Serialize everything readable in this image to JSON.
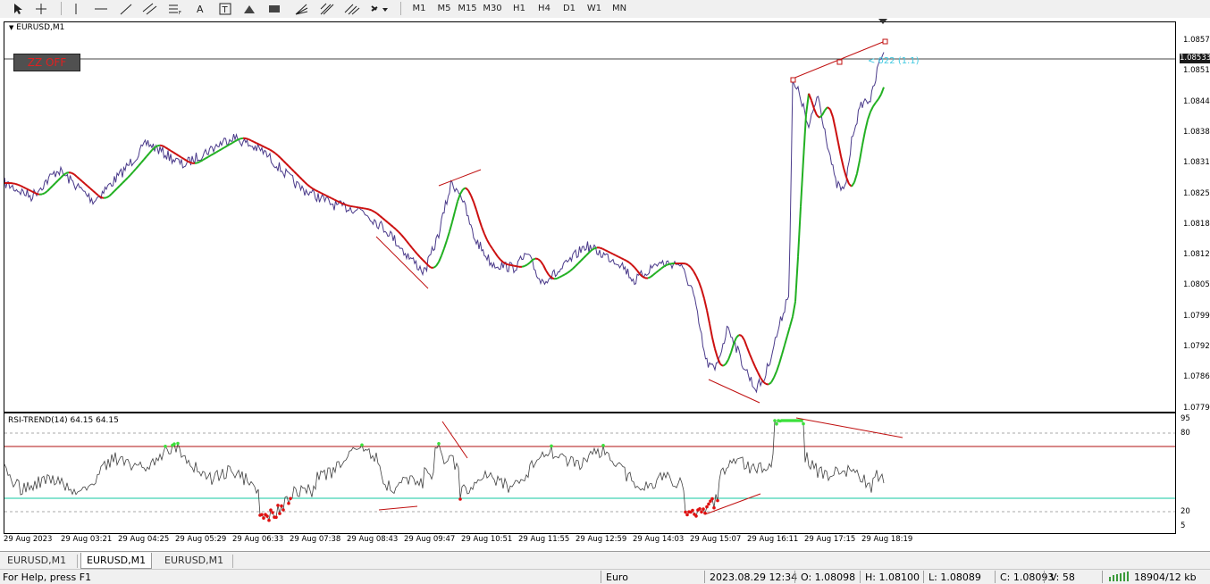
{
  "toolbar": {
    "timeframes": [
      "M1",
      "M5",
      "M15",
      "M30",
      "H1",
      "H4",
      "D1",
      "W1",
      "MN"
    ]
  },
  "main_chart": {
    "symbol_label": "EURUSD,M1",
    "zz_button": "ZZ OFF",
    "annotation": "< 022 (1.1)",
    "current_price": "1.08533",
    "price_ticks": [
      "1.08575",
      "1.08510",
      "1.08445",
      "1.08380",
      "1.08315",
      "1.08250",
      "1.08185",
      "1.08120",
      "1.08055",
      "1.07990",
      "1.07925",
      "1.07860",
      "1.07795"
    ]
  },
  "indicator": {
    "title": "RSI-TREND(14) 64.15 64.15",
    "levels": [
      "95",
      "80",
      "20",
      "5"
    ]
  },
  "time_axis": [
    "29 Aug 2023",
    "29 Aug 03:21",
    "29 Aug 04:25",
    "29 Aug 05:29",
    "29 Aug 06:33",
    "29 Aug 07:38",
    "29 Aug 08:43",
    "29 Aug 09:47",
    "29 Aug 10:51",
    "29 Aug 11:55",
    "29 Aug 12:59",
    "29 Aug 14:03",
    "29 Aug 15:07",
    "29 Aug 16:11",
    "29 Aug 17:15",
    "29 Aug 18:19"
  ],
  "tabs": [
    {
      "label": "EURUSD,M1",
      "active": false
    },
    {
      "label": "EURUSD,M1",
      "active": true
    },
    {
      "label": "EURUSD,M1",
      "active": false
    }
  ],
  "status_bar": {
    "help": "For Help, press F1",
    "profile": "Euro",
    "datetime": "2023.08.29 12:34",
    "open": "O: 1.08098",
    "high": "H: 1.08100",
    "low": "L: 1.08089",
    "close": "C: 1.08093",
    "volume": "V: 58",
    "traffic": "18904/12 kb"
  },
  "colors": {
    "ma_up": "#22b022",
    "ma_down": "#cc1010",
    "price_line": "#4a3a8a",
    "rsi_line": "#404040",
    "rsi_high": "#b01010",
    "rsi_low": "#10c8a0"
  }
}
